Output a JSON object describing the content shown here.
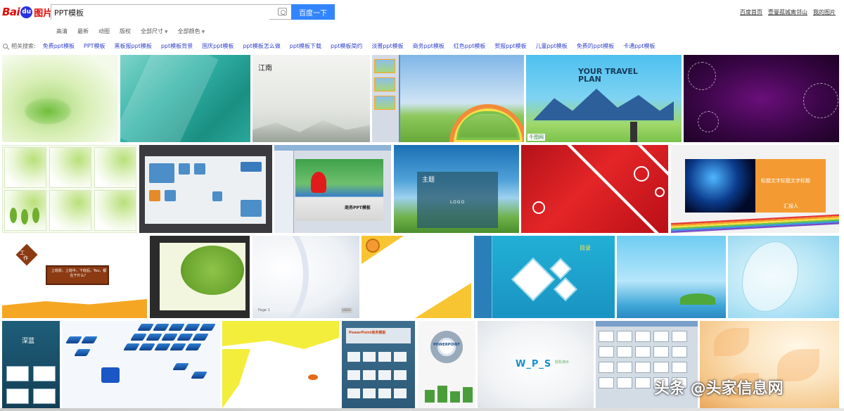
{
  "header": {
    "logo": {
      "bai": "Bai",
      "du": "du",
      "images": "图片"
    },
    "search": {
      "query": "PPT模板",
      "button": "百度一下"
    },
    "top_links": [
      "百度首页",
      "壹曼孤城离邻山",
      "我的图片"
    ]
  },
  "filters": [
    "高清",
    "最新",
    "动图",
    "版权",
    "全部尺寸",
    "全部颜色"
  ],
  "related": {
    "label": "相关搜索:",
    "items": [
      "免费ppt模板",
      "PPT模板",
      "黑板报ppt模板",
      "ppt模板背景",
      "国庆ppt模板",
      "ppt模板怎么做",
      "ppt模板下载",
      "ppt模板简约",
      "淡雅ppt模板",
      "商务ppt模板",
      "红色ppt模板",
      "贺报ppt模板",
      "儿童ppt模板",
      "免费的ppt模板",
      "卡通ppt模板"
    ]
  },
  "tiles": {
    "t3_title": "江南",
    "t5_title": "YOUR TRAVEL",
    "t5_title2": "PLAN",
    "t5_badge": "千图网",
    "t9_title": "商务PPT模板",
    "t10_title": "主题",
    "t10_logo": "LOGO",
    "t12_text": "标题文字标题文字标题",
    "t12_report": "汇报人",
    "t13_tag1": "工",
    "t13_tag2": "作",
    "t13_sign": "上班前，上班中，下班后。You，都在干什么？",
    "t15_page": "Page 1",
    "t15_logo": "LOGO",
    "t17_menu": "目录",
    "t20_title": "深蓝",
    "t23_head": "PowerPoint商务模板",
    "t24_title": "POWERPOINT",
    "t25_wps": "W_P_S",
    "t25_sub": "轻松演示"
  },
  "watermark": "头条 @头家信息网",
  "colors": {
    "brand_red": "#e10602",
    "brand_blue": "#3385ff",
    "link_blue": "#3344cc"
  }
}
